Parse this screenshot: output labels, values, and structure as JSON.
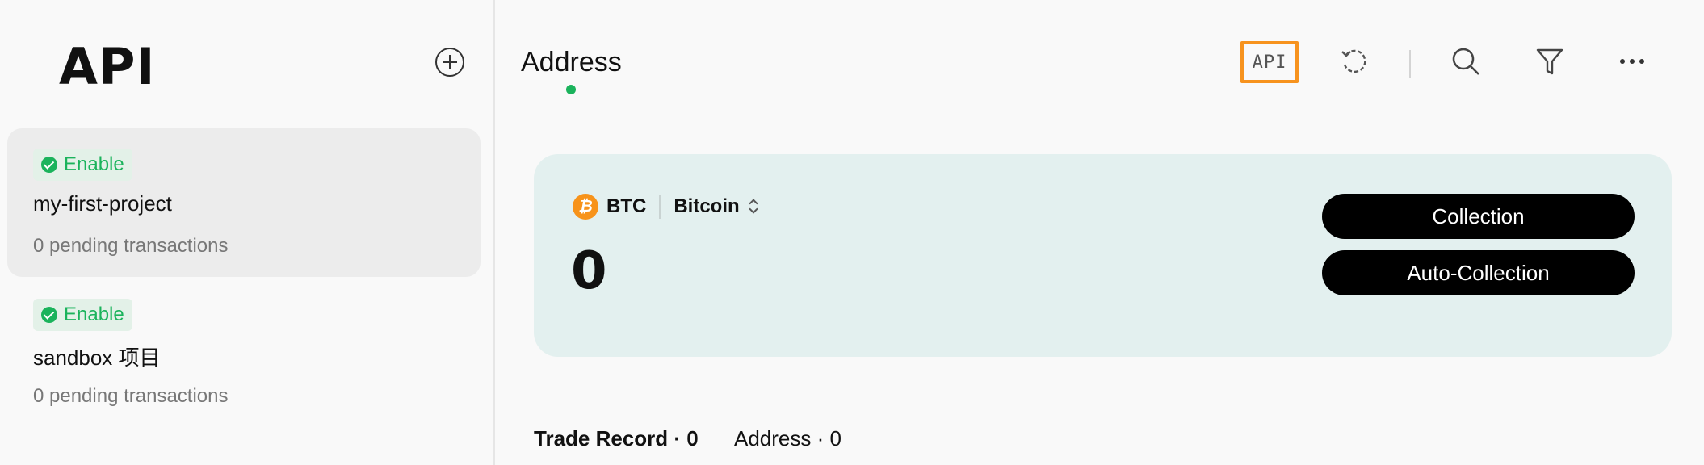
{
  "sidebar": {
    "title": "API",
    "add_icon": "plus-circle-icon",
    "projects": [
      {
        "status": "Enable",
        "name": "my-first-project",
        "pending": "0 pending transactions",
        "active": true
      },
      {
        "status": "Enable",
        "name": "sandbox 项目",
        "pending": "0 pending transactions",
        "active": false
      }
    ]
  },
  "header": {
    "tab_label": "Address",
    "toolbar": {
      "api_label": "API",
      "icons": [
        "api-icon",
        "refresh-icon",
        "search-icon",
        "filter-icon",
        "more-icon"
      ]
    }
  },
  "card": {
    "coin_symbol": "BTC",
    "coin_icon_glyph": "₿",
    "coin_name": "Bitcoin",
    "balance": "0",
    "collection_label": "Collection",
    "auto_collection_label": "Auto-Collection"
  },
  "bottom_tabs": {
    "trade_record": "Trade Record · 0",
    "address": "Address · 0"
  },
  "colors": {
    "accent_green": "#1bb35c",
    "badge_bg": "#e3f1e8",
    "btc_orange": "#f7931a",
    "highlight_orange": "#f7931e",
    "card_bg": "#e3f0ef"
  }
}
